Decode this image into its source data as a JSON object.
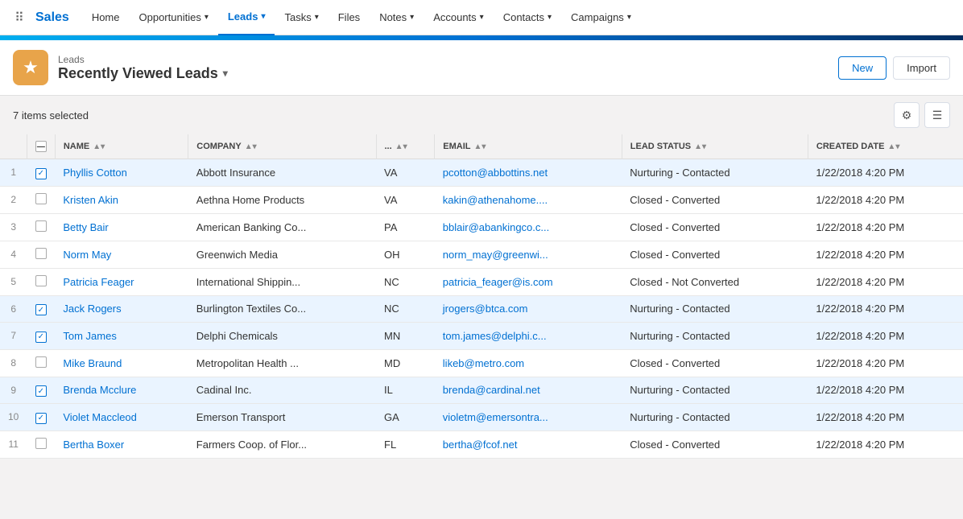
{
  "nav": {
    "brand": "Sales",
    "items": [
      {
        "label": "Home",
        "hasChevron": false,
        "active": false
      },
      {
        "label": "Opportunities",
        "hasChevron": true,
        "active": false
      },
      {
        "label": "Leads",
        "hasChevron": true,
        "active": true
      },
      {
        "label": "Tasks",
        "hasChevron": true,
        "active": false
      },
      {
        "label": "Files",
        "hasChevron": false,
        "active": false
      },
      {
        "label": "Notes",
        "hasChevron": true,
        "active": false
      },
      {
        "label": "Accounts",
        "hasChevron": true,
        "active": false
      },
      {
        "label": "Contacts",
        "hasChevron": true,
        "active": false
      },
      {
        "label": "Campaigns",
        "hasChevron": true,
        "active": false
      }
    ]
  },
  "page": {
    "breadcrumb": "Leads",
    "title": "Recently Viewed Leads",
    "icon": "★",
    "icon_bg": "#e8a44a"
  },
  "toolbar": {
    "items_selected": "7 items selected",
    "new_button": "New",
    "import_button": "Import"
  },
  "table": {
    "columns": [
      {
        "key": "name",
        "label": "NAME",
        "sortable": true
      },
      {
        "key": "company",
        "label": "COMPANY",
        "sortable": true
      },
      {
        "key": "state",
        "label": "...",
        "sortable": true
      },
      {
        "key": "email",
        "label": "EMAIL",
        "sortable": true
      },
      {
        "key": "lead_status",
        "label": "LEAD STATUS",
        "sortable": true
      },
      {
        "key": "created_date",
        "label": "CREATED DATE",
        "sortable": true
      }
    ],
    "rows": [
      {
        "num": 1,
        "checked": true,
        "name": "Phyllis Cotton",
        "company": "Abbott Insurance",
        "state": "VA",
        "email": "pcotton@abbottins.net",
        "lead_status": "Nurturing - Contacted",
        "created_date": "1/22/2018 4:20 PM"
      },
      {
        "num": 2,
        "checked": false,
        "name": "Kristen Akin",
        "company": "Aethna Home Products",
        "state": "VA",
        "email": "kakin@athenahome....",
        "lead_status": "Closed - Converted",
        "created_date": "1/22/2018 4:20 PM"
      },
      {
        "num": 3,
        "checked": false,
        "name": "Betty Bair",
        "company": "American Banking Co...",
        "state": "PA",
        "email": "bblair@abankingco.c...",
        "lead_status": "Closed - Converted",
        "created_date": "1/22/2018 4:20 PM"
      },
      {
        "num": 4,
        "checked": false,
        "name": "Norm May",
        "company": "Greenwich Media",
        "state": "OH",
        "email": "norm_may@greenwi...",
        "lead_status": "Closed - Converted",
        "created_date": "1/22/2018 4:20 PM"
      },
      {
        "num": 5,
        "checked": false,
        "name": "Patricia Feager",
        "company": "International Shippin...",
        "state": "NC",
        "email": "patricia_feager@is.com",
        "lead_status": "Closed - Not Converted",
        "created_date": "1/22/2018 4:20 PM"
      },
      {
        "num": 6,
        "checked": true,
        "name": "Jack Rogers",
        "company": "Burlington Textiles Co...",
        "state": "NC",
        "email": "jrogers@btca.com",
        "lead_status": "Nurturing - Contacted",
        "created_date": "1/22/2018 4:20 PM"
      },
      {
        "num": 7,
        "checked": true,
        "name": "Tom James",
        "company": "Delphi Chemicals",
        "state": "MN",
        "email": "tom.james@delphi.c...",
        "lead_status": "Nurturing - Contacted",
        "created_date": "1/22/2018 4:20 PM"
      },
      {
        "num": 8,
        "checked": false,
        "name": "Mike Braund",
        "company": "Metropolitan Health ...",
        "state": "MD",
        "email": "likeb@metro.com",
        "lead_status": "Closed - Converted",
        "created_date": "1/22/2018 4:20 PM"
      },
      {
        "num": 9,
        "checked": true,
        "name": "Brenda Mcclure",
        "company": "Cadinal Inc.",
        "state": "IL",
        "email": "brenda@cardinal.net",
        "lead_status": "Nurturing - Contacted",
        "created_date": "1/22/2018 4:20 PM"
      },
      {
        "num": 10,
        "checked": true,
        "name": "Violet Maccleod",
        "company": "Emerson Transport",
        "state": "GA",
        "email": "violetm@emersontra...",
        "lead_status": "Nurturing - Contacted",
        "created_date": "1/22/2018 4:20 PM"
      },
      {
        "num": 11,
        "checked": false,
        "name": "Bertha Boxer",
        "company": "Farmers Coop. of Flor...",
        "state": "FL",
        "email": "bertha@fcof.net",
        "lead_status": "Closed - Converted",
        "created_date": "1/22/2018 4:20 PM"
      }
    ]
  }
}
